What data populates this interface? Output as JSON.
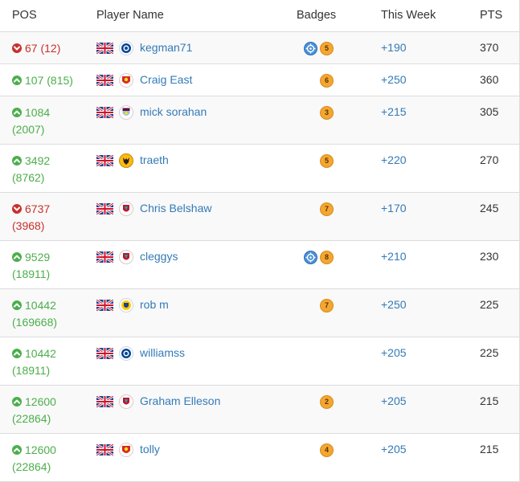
{
  "header": {
    "pos": "POS",
    "player_name": "Player Name",
    "badges": "Badges",
    "this_week": "This Week",
    "pts": "PTS"
  },
  "colors": {
    "up": "#4cae4c",
    "down": "#c9302c",
    "link": "#337ab7",
    "badge_orange": "#f4a632",
    "badge_blue": "#4a90d9"
  },
  "rows": [
    {
      "direction": "down",
      "pos": "67 (12)",
      "pos_line2": "",
      "club": "chelsea-crest-icon",
      "name": "kegman71",
      "badges": [
        "target",
        "5"
      ],
      "week": "+190",
      "pts": "370"
    },
    {
      "direction": "up",
      "pos": "107 (815)",
      "pos_line2": "",
      "club": "man-utd-crest-icon",
      "name": "Craig East",
      "badges": [
        "6"
      ],
      "week": "+250",
      "pts": "360"
    },
    {
      "direction": "up",
      "pos": "1084",
      "pos_line2": "(2007)",
      "club": "aston-villa-crest-icon",
      "name": "mick sorahan",
      "badges": [
        "3"
      ],
      "week": "+215",
      "pts": "305"
    },
    {
      "direction": "up",
      "pos": "3492",
      "pos_line2": "(8762)",
      "club": "wolves-crest-icon",
      "name": "traeth",
      "badges": [
        "5"
      ],
      "week": "+220",
      "pts": "270"
    },
    {
      "direction": "down",
      "pos": "6737",
      "pos_line2": "(3968)",
      "club": "liverpool-crest-icon",
      "name": "Chris Belshaw",
      "badges": [
        "7"
      ],
      "week": "+170",
      "pts": "245"
    },
    {
      "direction": "up",
      "pos": "9529",
      "pos_line2": "(18911)",
      "club": "liverpool-crest-icon",
      "name": "cleggys",
      "badges": [
        "target",
        "8"
      ],
      "week": "+210",
      "pts": "230"
    },
    {
      "direction": "up",
      "pos": "10442",
      "pos_line2": "(169668)",
      "club": "leeds-crest-icon",
      "name": "rob m",
      "badges": [
        "7"
      ],
      "week": "+250",
      "pts": "225"
    },
    {
      "direction": "up",
      "pos": "10442",
      "pos_line2": "(18911)",
      "club": "chelsea-crest-icon",
      "name": "williamss",
      "badges": [],
      "week": "+205",
      "pts": "225"
    },
    {
      "direction": "up",
      "pos": "12600",
      "pos_line2": "(22864)",
      "club": "liverpool-crest-icon",
      "name": "Graham Elleson",
      "badges": [
        "2"
      ],
      "week": "+205",
      "pts": "215"
    },
    {
      "direction": "up",
      "pos": "12600",
      "pos_line2": "(22864)",
      "club": "man-utd-crest-icon",
      "name": "tolly",
      "badges": [
        "4"
      ],
      "week": "+205",
      "pts": "215"
    }
  ]
}
